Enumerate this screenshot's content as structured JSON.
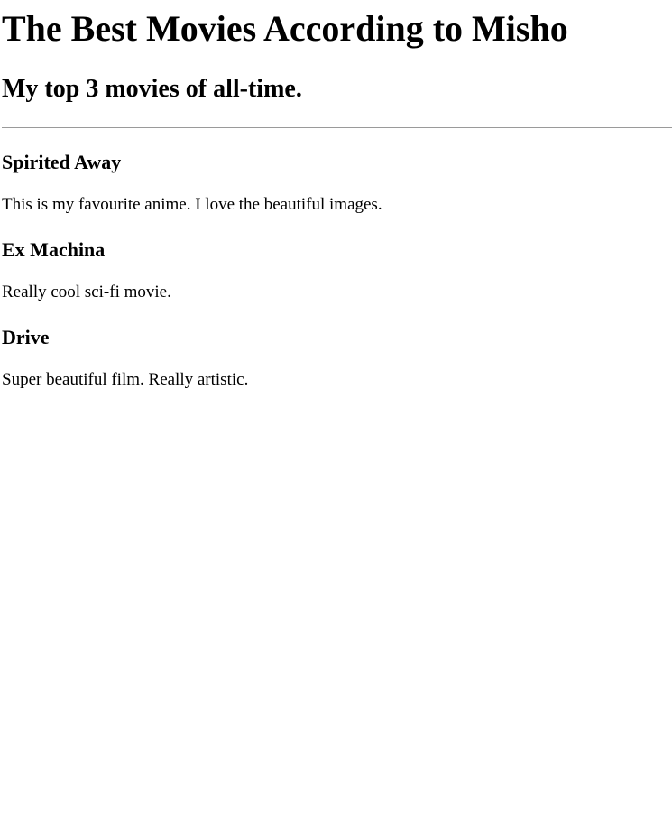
{
  "header": {
    "title": "The Best Movies According to Misho",
    "subtitle": "My top 3 movies of all-time."
  },
  "movies": [
    {
      "title": "Spirited Away",
      "description": "This is my favourite anime. I love the beautiful images."
    },
    {
      "title": "Ex Machina",
      "description": "Really cool sci-fi movie."
    },
    {
      "title": "Drive",
      "description": "Super beautiful film. Really artistic."
    }
  ]
}
